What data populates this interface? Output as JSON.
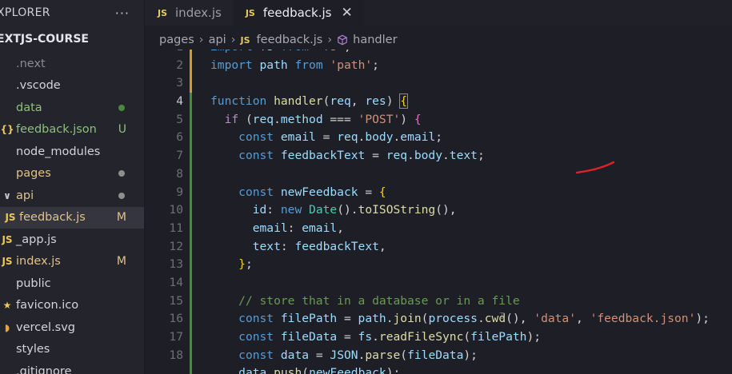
{
  "explorer": {
    "title": "XPLORER",
    "project": "EXTJS-COURSE",
    "items": [
      {
        "label": ".next",
        "indent": 0,
        "icon": "folder-icon",
        "muted": true
      },
      {
        "label": ".vscode",
        "indent": 0,
        "icon": "folder-icon"
      },
      {
        "label": "data",
        "indent": 0,
        "icon": "folder-icon",
        "color": "#8ec07c",
        "dot": "#4a8a40"
      },
      {
        "label": "feedback.json",
        "indent": 0,
        "icon": "json-file-icon",
        "iconText": "{}",
        "iconColor": "#e8c95a",
        "color": "#8ec07c",
        "status": "U",
        "statusColor": "#8ec07c"
      },
      {
        "label": "node_modules",
        "indent": 0,
        "icon": "folder-icon"
      },
      {
        "label": "pages",
        "indent": 0,
        "icon": "folder-icon",
        "color": "#e0c28a",
        "dot": "#8e8e8e"
      },
      {
        "label": "api",
        "indent": 0,
        "icon": "chevron-down-icon",
        "iconText": "∨",
        "iconColor": "#c9c9cf",
        "color": "#e0c28a",
        "dot": "#8e8e8e"
      },
      {
        "label": "feedback.js",
        "indent": 1,
        "icon": "js-file-icon",
        "iconText": "JS",
        "iconColor": "#e8c95a",
        "color": "#e0c28a",
        "status": "M",
        "statusColor": "#e0c28a",
        "active": true
      },
      {
        "label": "_app.js",
        "indent": 0,
        "icon": "js-file-icon",
        "iconText": "JS",
        "iconColor": "#e8c95a"
      },
      {
        "label": "index.js",
        "indent": 0,
        "icon": "js-file-icon",
        "iconText": "JS",
        "iconColor": "#e8c95a",
        "color": "#e0c28a",
        "status": "M",
        "statusColor": "#e0c28a"
      },
      {
        "label": "public",
        "indent": 0,
        "icon": "folder-icon"
      },
      {
        "label": "favicon.ico",
        "indent": 0,
        "icon": "star-icon",
        "iconText": "★",
        "iconColor": "#e8c95a"
      },
      {
        "label": "vercel.svg",
        "indent": 0,
        "icon": "svg-file-icon",
        "iconText": "◗",
        "iconColor": "#e8a33a"
      },
      {
        "label": "styles",
        "indent": 0,
        "icon": "folder-icon"
      },
      {
        "label": ".gitignore",
        "indent": 0,
        "icon": "git-file-icon"
      }
    ]
  },
  "tabs": [
    {
      "label": "index.js"
    },
    {
      "label": "feedback.js"
    }
  ],
  "breadcrumb": [
    "pages",
    "api",
    "feedback.js",
    "handler"
  ],
  "code": [
    {
      "n": "1",
      "tokens": [
        [
          "k",
          "import"
        ],
        [
          "p",
          " "
        ],
        [
          "v",
          "fs"
        ],
        [
          "p",
          " "
        ],
        [
          "k",
          "from"
        ],
        [
          "p",
          " "
        ],
        [
          "s",
          "'fs'"
        ],
        [
          "p",
          ";"
        ]
      ]
    },
    {
      "n": "2",
      "tokens": [
        [
          "k",
          "import"
        ],
        [
          "p",
          " "
        ],
        [
          "v",
          "path"
        ],
        [
          "p",
          " "
        ],
        [
          "k",
          "from"
        ],
        [
          "p",
          " "
        ],
        [
          "s",
          "'path'"
        ],
        [
          "p",
          ";"
        ]
      ]
    },
    {
      "n": "3",
      "tokens": []
    },
    {
      "n": "4",
      "tokens": [
        [
          "k",
          "function"
        ],
        [
          "p",
          " "
        ],
        [
          "f",
          "handler"
        ],
        [
          "p",
          "("
        ],
        [
          "v",
          "req"
        ],
        [
          "p",
          ", "
        ],
        [
          "v",
          "res"
        ],
        [
          "p",
          ") "
        ],
        [
          "bm",
          "{"
        ]
      ],
      "current": true
    },
    {
      "n": "5",
      "tokens": [
        [
          "p",
          "  "
        ],
        [
          "kw2",
          "if"
        ],
        [
          "p",
          " ("
        ],
        [
          "v",
          "req"
        ],
        [
          "p",
          "."
        ],
        [
          "v",
          "method"
        ],
        [
          "p",
          " === "
        ],
        [
          "s",
          "'POST'"
        ],
        [
          "p",
          ") "
        ],
        [
          "pk",
          "{"
        ]
      ]
    },
    {
      "n": "6",
      "tokens": [
        [
          "p",
          "    "
        ],
        [
          "k",
          "const"
        ],
        [
          "p",
          " "
        ],
        [
          "v",
          "email"
        ],
        [
          "p",
          " = "
        ],
        [
          "v",
          "req"
        ],
        [
          "p",
          "."
        ],
        [
          "v",
          "body"
        ],
        [
          "p",
          "."
        ],
        [
          "v",
          "email"
        ],
        [
          "p",
          ";"
        ]
      ]
    },
    {
      "n": "7",
      "tokens": [
        [
          "p",
          "    "
        ],
        [
          "k",
          "const"
        ],
        [
          "p",
          " "
        ],
        [
          "v",
          "feedbackText"
        ],
        [
          "p",
          " = "
        ],
        [
          "v",
          "req"
        ],
        [
          "p",
          "."
        ],
        [
          "v",
          "body"
        ],
        [
          "p",
          "."
        ],
        [
          "v",
          "text"
        ],
        [
          "p",
          ";"
        ]
      ]
    },
    {
      "n": "8",
      "tokens": []
    },
    {
      "n": "9",
      "tokens": [
        [
          "p",
          "    "
        ],
        [
          "k",
          "const"
        ],
        [
          "p",
          " "
        ],
        [
          "v",
          "newFeedback"
        ],
        [
          "p",
          " = "
        ],
        [
          "y",
          "{"
        ]
      ]
    },
    {
      "n": "10",
      "tokens": [
        [
          "p",
          "      "
        ],
        [
          "v",
          "id"
        ],
        [
          "p",
          ": "
        ],
        [
          "k",
          "new"
        ],
        [
          "p",
          " "
        ],
        [
          "t",
          "Date"
        ],
        [
          "p",
          "()."
        ],
        [
          "f",
          "toISOString"
        ],
        [
          "p",
          "(),"
        ]
      ]
    },
    {
      "n": "11",
      "tokens": [
        [
          "p",
          "      "
        ],
        [
          "v",
          "email"
        ],
        [
          "p",
          ": "
        ],
        [
          "v",
          "email"
        ],
        [
          "p",
          ","
        ]
      ]
    },
    {
      "n": "12",
      "tokens": [
        [
          "p",
          "      "
        ],
        [
          "v",
          "text"
        ],
        [
          "p",
          ": "
        ],
        [
          "v",
          "feedbackText"
        ],
        [
          "p",
          ","
        ]
      ]
    },
    {
      "n": "13",
      "tokens": [
        [
          "p",
          "    "
        ],
        [
          "y",
          "}"
        ],
        [
          "p",
          ";"
        ]
      ]
    },
    {
      "n": "14",
      "tokens": []
    },
    {
      "n": "15",
      "tokens": [
        [
          "p",
          "    "
        ],
        [
          "c",
          "// store that in a database or in a file"
        ]
      ]
    },
    {
      "n": "16",
      "tokens": [
        [
          "p",
          "    "
        ],
        [
          "k",
          "const"
        ],
        [
          "p",
          " "
        ],
        [
          "v",
          "filePath"
        ],
        [
          "p",
          " = "
        ],
        [
          "v",
          "path"
        ],
        [
          "p",
          "."
        ],
        [
          "f",
          "join"
        ],
        [
          "p",
          "("
        ],
        [
          "v",
          "process"
        ],
        [
          "p",
          "."
        ],
        [
          "f",
          "cwd"
        ],
        [
          "p",
          "(), "
        ],
        [
          "s",
          "'data'"
        ],
        [
          "p",
          ", "
        ],
        [
          "s",
          "'feedback.json'"
        ],
        [
          "p",
          ");"
        ]
      ]
    },
    {
      "n": "17",
      "tokens": [
        [
          "p",
          "    "
        ],
        [
          "k",
          "const"
        ],
        [
          "p",
          " "
        ],
        [
          "v",
          "fileData"
        ],
        [
          "p",
          " = "
        ],
        [
          "v",
          "fs"
        ],
        [
          "p",
          "."
        ],
        [
          "f",
          "readFileSync"
        ],
        [
          "p",
          "("
        ],
        [
          "v",
          "filePath"
        ],
        [
          "p",
          ");"
        ]
      ]
    },
    {
      "n": "18",
      "tokens": [
        [
          "p",
          "    "
        ],
        [
          "k",
          "const"
        ],
        [
          "p",
          " "
        ],
        [
          "v",
          "data"
        ],
        [
          "p",
          " = "
        ],
        [
          "v",
          "JSON"
        ],
        [
          "p",
          "."
        ],
        [
          "f",
          "parse"
        ],
        [
          "p",
          "("
        ],
        [
          "v",
          "fileData"
        ],
        [
          "p",
          ");"
        ]
      ]
    },
    {
      "n": "",
      "tokens": [
        [
          "p",
          "    "
        ],
        [
          "v",
          "data"
        ],
        [
          "p",
          "."
        ],
        [
          "f",
          "push"
        ],
        [
          "p",
          "("
        ],
        [
          "v",
          "newFeedback"
        ],
        [
          "p",
          ");"
        ]
      ]
    }
  ]
}
